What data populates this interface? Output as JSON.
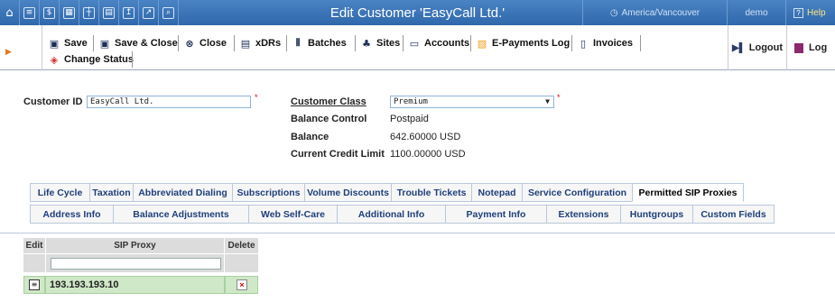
{
  "header": {
    "title": "Edit Customer 'EasyCall Ltd.'",
    "timezone": "America/Vancouver",
    "user": "demo",
    "help": "Help"
  },
  "toolbar": {
    "save": "Save",
    "save_close": "Save & Close",
    "close": "Close",
    "xdrs": "xDRs",
    "batches": "Batches",
    "sites": "Sites",
    "accounts": "Accounts",
    "epayments": "E-Payments Log",
    "invoices": "Invoices",
    "change_status": "Change Status",
    "logout": "Logout",
    "log": "Log"
  },
  "form": {
    "customer_id_label": "Customer ID",
    "customer_id_value": "EasyCall Ltd.",
    "customer_class_label": "Customer Class",
    "customer_class_value": "Premium",
    "balance_control_label": "Balance Control",
    "balance_control_value": "Postpaid",
    "balance_label": "Balance",
    "balance_value": "642.60000 USD",
    "credit_limit_label": "Current Credit Limit",
    "credit_limit_value": "1100.00000 USD"
  },
  "tabs_row1": [
    "Life Cycle",
    "Taxation",
    "Abbreviated Dialing",
    "Subscriptions",
    "Volume Discounts",
    "Trouble Tickets",
    "Notepad",
    "Service Configuration",
    "Permitted SIP Proxies"
  ],
  "tabs_row2": [
    "Address Info",
    "Balance Adjustments",
    "Web Self-Care",
    "Additional Info",
    "Payment Info",
    "Extensions",
    "Huntgroups",
    "Custom Fields"
  ],
  "active_tab": "Permitted SIP Proxies",
  "grid": {
    "col_edit": "Edit",
    "col_proxy": "SIP Proxy",
    "col_delete": "Delete",
    "rows": [
      {
        "proxy": "193.193.193.10"
      }
    ]
  }
}
